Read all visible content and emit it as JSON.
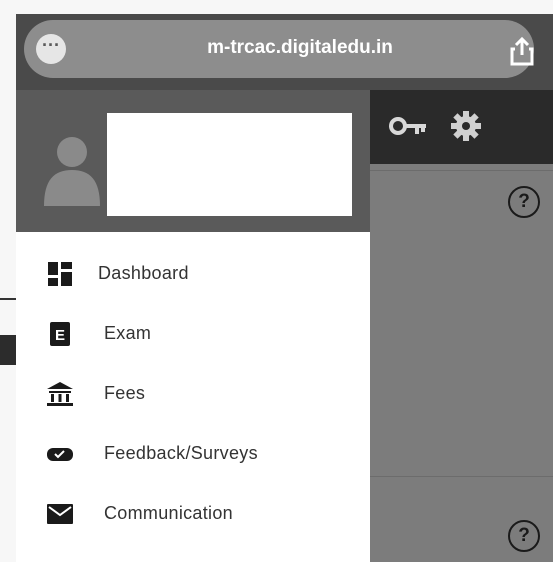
{
  "browser": {
    "url": "m-trcac.digitaledu.in",
    "menu_icon": "more-dots-icon",
    "share_icon": "share-icon"
  },
  "header": {
    "key_icon": "key-icon",
    "settings_icon": "gear-icon"
  },
  "drawer": {
    "avatar_icon": "user-avatar-icon",
    "items": [
      {
        "label": "Dashboard",
        "icon": "dashboard-icon"
      },
      {
        "label": "Exam",
        "icon": "exam-icon"
      },
      {
        "label": "Fees",
        "icon": "bank-icon"
      },
      {
        "label": "Feedback/Surveys",
        "icon": "feedback-icon"
      },
      {
        "label": "Communication",
        "icon": "envelope-icon"
      }
    ]
  },
  "content": {
    "help_symbol": "?",
    "help_symbol_2": "?"
  },
  "colors": {
    "header": "#3b3b3b",
    "overlay": "#7c7c7c",
    "drawer": "#ffffff"
  }
}
